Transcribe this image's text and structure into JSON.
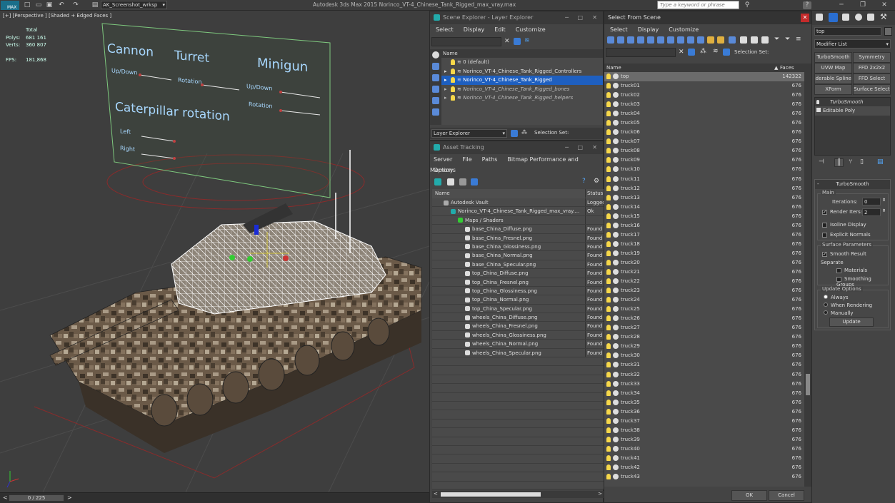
{
  "app": {
    "logo": "MAX",
    "project": "AK_Screenshot_wrksp",
    "title": "Autodesk 3ds Max  2015      Norinco_VT-4_Chinese_Tank_Rigged_max_vray.max",
    "search_placeholder": "Type a keyword or phrase"
  },
  "viewport": {
    "label": "[+] [Perspective ] [Shaded + Edged Faces ]",
    "stats": {
      "total": "Total",
      "polys_label": "Polys:",
      "polys": "681 161",
      "verts_label": "Verts:",
      "verts": "360 807",
      "fps_label": "FPS:",
      "fps": "181,868"
    },
    "board": {
      "cannon": "Cannon",
      "turret": "Turret",
      "minigun": "Minigun",
      "updown": "Up/Down",
      "rotation": "Rotation",
      "updown2": "Up/Down",
      "rotation2": "Rotation",
      "caterpillar": "Caterpillar rotation",
      "left": "Left",
      "right": "Right"
    }
  },
  "timeline": {
    "frame": "0 / 225"
  },
  "scene_explorer": {
    "title": "Scene Explorer - Layer Explorer",
    "menu": [
      "Select",
      "Display",
      "Edit",
      "Customize"
    ],
    "col_name": "Name",
    "rows": [
      {
        "label": "0 (default)",
        "italic": false,
        "selected": false
      },
      {
        "label": "Norinco_VT-4_Chinese_Tank_Rigged_Controllers",
        "italic": false,
        "selected": false
      },
      {
        "label": "Norinco_VT-4_Chinese_Tank_Rigged",
        "italic": false,
        "selected": true
      },
      {
        "label": "Norinco_VT-4_Chinese_Tank_Rigged_bones",
        "italic": true,
        "selected": false
      },
      {
        "label": "Norinco_VT-4_Chinese_Tank_Rigged_helpers",
        "italic": true,
        "selected": false
      }
    ],
    "footer_dropdown": "Layer Explorer",
    "selection_set": "Selection Set:"
  },
  "asset_tracking": {
    "title": "Asset Tracking",
    "menu": [
      "Server",
      "File",
      "Paths",
      "Bitmap Performance and Memory"
    ],
    "menu2": "Options",
    "col_name": "Name",
    "col_status": "Status",
    "rows": [
      {
        "name": "Autodesk Vault",
        "status": "Logged",
        "indent": 1
      },
      {
        "name": "Norinco_VT-4_Chinese_Tank_Rigged_max_vray....",
        "status": "Ok",
        "indent": 2
      },
      {
        "name": "Maps / Shaders",
        "status": "",
        "indent": 3
      },
      {
        "name": "base_China_Diffuse.png",
        "status": "Found",
        "indent": 4
      },
      {
        "name": "base_China_Fresnel.png",
        "status": "Found",
        "indent": 4
      },
      {
        "name": "base_China_Glossiness.png",
        "status": "Found",
        "indent": 4
      },
      {
        "name": "base_China_Normal.png",
        "status": "Found",
        "indent": 4
      },
      {
        "name": "base_China_Specular.png",
        "status": "Found",
        "indent": 4
      },
      {
        "name": "top_China_Diffuse.png",
        "status": "Found",
        "indent": 4
      },
      {
        "name": "top_China_Fresnel.png",
        "status": "Found",
        "indent": 4
      },
      {
        "name": "top_China_Glossiness.png",
        "status": "Found",
        "indent": 4
      },
      {
        "name": "top_China_Normal.png",
        "status": "Found",
        "indent": 4
      },
      {
        "name": "top_China_Specular.png",
        "status": "Found",
        "indent": 4
      },
      {
        "name": "wheels_China_Diffuse.png",
        "status": "Found",
        "indent": 4
      },
      {
        "name": "wheels_China_Fresnel.png",
        "status": "Found",
        "indent": 4
      },
      {
        "name": "wheels_China_Glossiness.png",
        "status": "Found",
        "indent": 4
      },
      {
        "name": "wheels_China_Normal.png",
        "status": "Found",
        "indent": 4
      },
      {
        "name": "wheels_China_Specular.png",
        "status": "Found",
        "indent": 4
      }
    ]
  },
  "select_from_scene": {
    "title": "Select From Scene",
    "menu": [
      "Select",
      "Display",
      "Customize"
    ],
    "selection_set": "Selection Set:",
    "col_name": "Name",
    "col_faces": "Faces",
    "rows": [
      {
        "name": "top",
        "faces": "142322"
      },
      {
        "name": "truck01",
        "faces": "676"
      },
      {
        "name": "truck02",
        "faces": "676"
      },
      {
        "name": "truck03",
        "faces": "676"
      },
      {
        "name": "truck04",
        "faces": "676"
      },
      {
        "name": "truck05",
        "faces": "676"
      },
      {
        "name": "truck06",
        "faces": "676"
      },
      {
        "name": "truck07",
        "faces": "676"
      },
      {
        "name": "truck08",
        "faces": "676"
      },
      {
        "name": "truck09",
        "faces": "676"
      },
      {
        "name": "truck10",
        "faces": "676"
      },
      {
        "name": "truck11",
        "faces": "676"
      },
      {
        "name": "truck12",
        "faces": "676"
      },
      {
        "name": "truck13",
        "faces": "676"
      },
      {
        "name": "truck14",
        "faces": "676"
      },
      {
        "name": "truck15",
        "faces": "676"
      },
      {
        "name": "truck16",
        "faces": "676"
      },
      {
        "name": "truck17",
        "faces": "676"
      },
      {
        "name": "truck18",
        "faces": "676"
      },
      {
        "name": "truck19",
        "faces": "676"
      },
      {
        "name": "truck20",
        "faces": "676"
      },
      {
        "name": "truck21",
        "faces": "676"
      },
      {
        "name": "truck22",
        "faces": "676"
      },
      {
        "name": "truck23",
        "faces": "676"
      },
      {
        "name": "truck24",
        "faces": "676"
      },
      {
        "name": "truck25",
        "faces": "676"
      },
      {
        "name": "truck26",
        "faces": "676"
      },
      {
        "name": "truck27",
        "faces": "676"
      },
      {
        "name": "truck28",
        "faces": "676"
      },
      {
        "name": "truck29",
        "faces": "676"
      },
      {
        "name": "truck30",
        "faces": "676"
      },
      {
        "name": "truck31",
        "faces": "676"
      },
      {
        "name": "truck32",
        "faces": "676"
      },
      {
        "name": "truck33",
        "faces": "676"
      },
      {
        "name": "truck34",
        "faces": "676"
      },
      {
        "name": "truck35",
        "faces": "676"
      },
      {
        "name": "truck36",
        "faces": "676"
      },
      {
        "name": "truck37",
        "faces": "676"
      },
      {
        "name": "truck38",
        "faces": "676"
      },
      {
        "name": "truck39",
        "faces": "676"
      },
      {
        "name": "truck40",
        "faces": "676"
      },
      {
        "name": "truck41",
        "faces": "676"
      },
      {
        "name": "truck42",
        "faces": "676"
      },
      {
        "name": "truck43",
        "faces": "676"
      }
    ],
    "ok": "OK",
    "cancel": "Cancel"
  },
  "modifier_panel": {
    "object_name": "top",
    "modifier_list": "Modifier List",
    "buttons": [
      "TurboSmooth",
      "Symmetry",
      "UVW Map",
      "FFD 2x2x2",
      "Renderable Spline",
      "FFD Select",
      "XForm",
      "Surface Select"
    ],
    "stack": [
      "TurboSmooth",
      "Editable Poly"
    ],
    "rollout_title": "TurboSmooth",
    "main_label": "Main",
    "iterations_label": "Iterations:",
    "iterations": "0",
    "render_iters_label": "Render Iters:",
    "render_iters": "2",
    "isoline": "Isoline Display",
    "explicit_normals": "Explicit Normals",
    "surface_params": "Surface Parameters",
    "smooth_result": "Smooth Result",
    "separate": "Separate",
    "materials": "Materials",
    "smoothing_groups": "Smoothing Groups",
    "update_options": "Update Options",
    "always": "Always",
    "when_rendering": "When Rendering",
    "manually": "Manually",
    "update_btn": "Update"
  },
  "colors": {
    "accent": "#1e5fc0",
    "board": "#7ec87e",
    "board_text": "#a8d8ff",
    "red_guides": "#9b2a2a"
  }
}
